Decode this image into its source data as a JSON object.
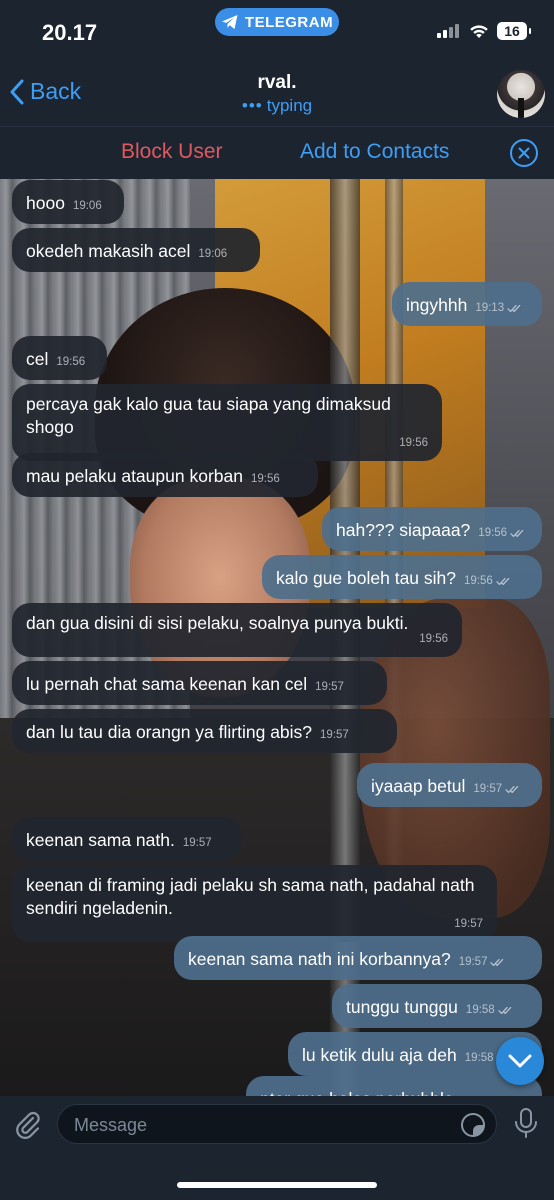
{
  "status_bar": {
    "time": "20.17",
    "app_pill": "TELEGRAM",
    "battery": "16"
  },
  "header": {
    "back_label": "Back",
    "title": "rval.",
    "status": "typing",
    "status_dots": "•••"
  },
  "action_bar": {
    "block_label": "Block User",
    "add_label": "Add to Contacts"
  },
  "messages": [
    {
      "dir": "in",
      "text": "hooo",
      "time": "19:06"
    },
    {
      "dir": "in",
      "text": "okedeh makasih acel",
      "time": "19:06"
    },
    {
      "dir": "out",
      "text": "ingyhhh",
      "time": "19:13"
    },
    {
      "dir": "in",
      "text": "cel",
      "time": "19:56"
    },
    {
      "dir": "in",
      "text": "percaya gak kalo gua tau siapa yang dimaksud shogo",
      "time": "19:56"
    },
    {
      "dir": "in",
      "text": "mau pelaku ataupun korban",
      "time": "19:56"
    },
    {
      "dir": "out",
      "text": "hah??? siapaaa?",
      "time": "19:56"
    },
    {
      "dir": "out",
      "text": "kalo gue boleh tau sih?",
      "time": "19:56"
    },
    {
      "dir": "in",
      "text": "dan gua disini di sisi pelaku, soalnya punya bukti.",
      "time": "19:56"
    },
    {
      "dir": "in",
      "text": "lu pernah chat sama keenan kan cel",
      "time": "19:57"
    },
    {
      "dir": "in",
      "text": "dan lu tau dia orangn ya flirting abis?",
      "time": "19:57"
    },
    {
      "dir": "out",
      "text": "iyaaap betul",
      "time": "19:57"
    },
    {
      "dir": "in",
      "text": "keenan sama nath.",
      "time": "19:57"
    },
    {
      "dir": "in",
      "text": "keenan di framing jadi pelaku sh sama nath, padahal nath sendiri ngeladenin.",
      "time": "19:57"
    },
    {
      "dir": "out",
      "text": "keenan sama nath ini korbannya?",
      "time": "19:57"
    },
    {
      "dir": "out",
      "text": "tunggu tunggu",
      "time": "19:58"
    },
    {
      "dir": "out",
      "text": "lu ketik dulu aja deh",
      "time": "19:58"
    },
    {
      "dir": "out",
      "text": "ntar gue bales perbubble",
      "time": ""
    }
  ],
  "composer": {
    "placeholder": "Message"
  },
  "colors": {
    "accent": "#3d9ef5",
    "danger": "#e2585f",
    "bar_bg": "#1c2430",
    "bubble_in": "#21262e",
    "bubble_out": "#4e6f8c"
  }
}
